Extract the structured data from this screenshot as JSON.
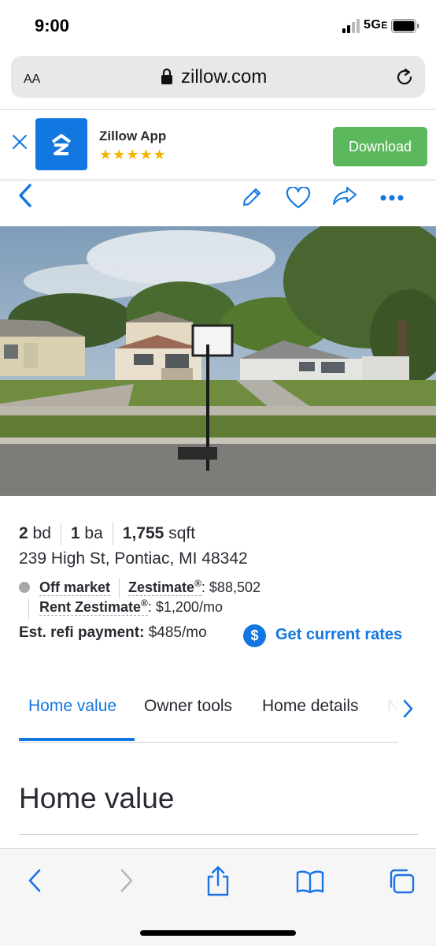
{
  "status_bar": {
    "time": "9:00",
    "network": "5G",
    "network_suffix": "E"
  },
  "url_bar": {
    "text_size": "AA",
    "host": "zillow.com"
  },
  "app_banner": {
    "name": "Zillow App",
    "stars": "★★★★★",
    "button": "Download"
  },
  "listing": {
    "beds_value": "2",
    "beds_unit": "bd",
    "baths_value": "1",
    "baths_unit": "ba",
    "sqft_value": "1,755",
    "sqft_unit": "sqft",
    "address": "239 High St, Pontiac, MI 48342",
    "status": "Off market",
    "zestimate_label": "Zestimate",
    "zestimate_value": ": $88,502",
    "rent_label": "Rent Zestimate",
    "rent_value": ": $1,200/mo",
    "refi_label": "Est. refi payment:",
    "refi_value": "$485/mo",
    "rates_link": "Get current rates",
    "dollar_symbol": "$",
    "registered": "®"
  },
  "tabs": [
    {
      "label": "Home value",
      "active": true
    },
    {
      "label": "Owner tools",
      "active": false
    },
    {
      "label": "Home details",
      "active": false
    },
    {
      "label": "N",
      "active": false
    }
  ],
  "section_heading": "Home value",
  "colors": {
    "brand_blue": "#1277e1",
    "download_green": "#5cb85c",
    "star_gold": "#f4b400"
  }
}
